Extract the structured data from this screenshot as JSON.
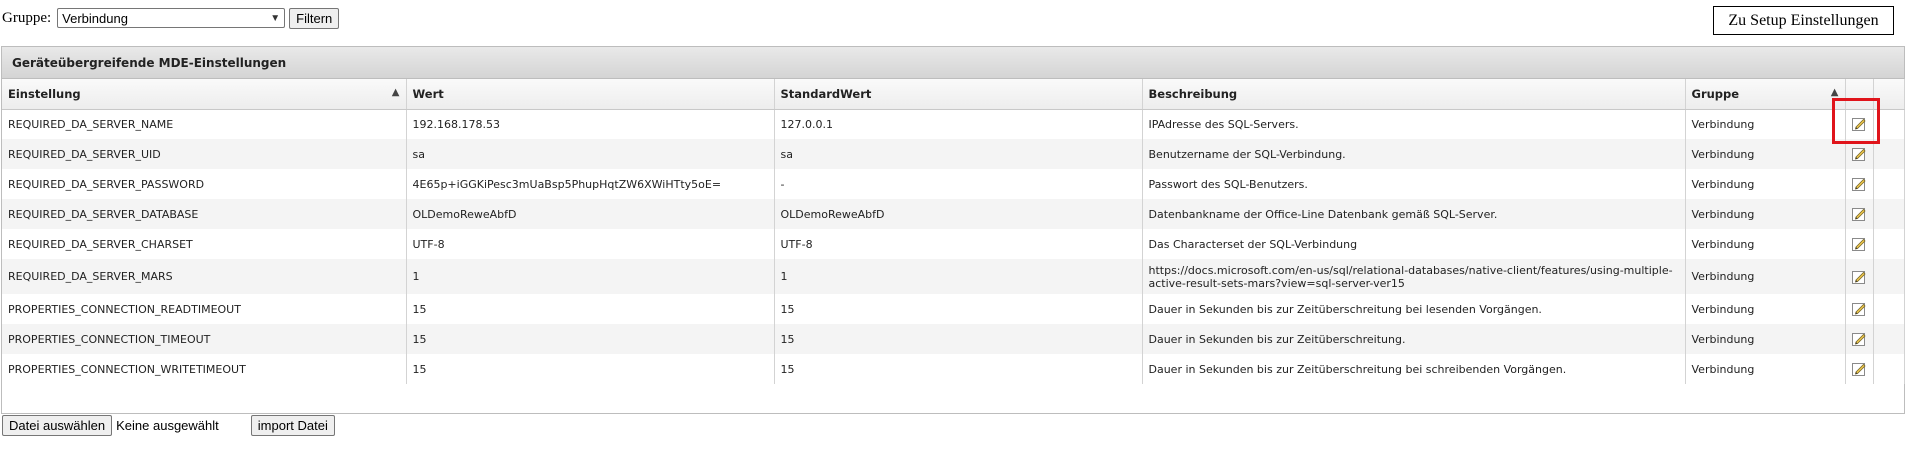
{
  "filter": {
    "label": "Gruppe:",
    "selected": "Verbindung",
    "button": "Filtern"
  },
  "setup_button": "Zu Setup Einstellungen",
  "grid": {
    "title": "Geräteübergreifende MDE-Einstellungen",
    "columns": [
      "Einstellung",
      "Wert",
      "StandardWert",
      "Beschreibung",
      "Gruppe"
    ],
    "rows": [
      {
        "einstellung": "REQUIRED_DA_SERVER_NAME",
        "wert": "192.168.178.53",
        "standard": "127.0.0.1",
        "beschreibung": "IPAdresse des SQL-Servers.",
        "gruppe": "Verbindung"
      },
      {
        "einstellung": "REQUIRED_DA_SERVER_UID",
        "wert": "sa",
        "standard": "sa",
        "beschreibung": "Benutzername der SQL-Verbindung.",
        "gruppe": "Verbindung"
      },
      {
        "einstellung": "REQUIRED_DA_SERVER_PASSWORD",
        "wert": "4E65p+iGGKiPesc3mUaBsp5PhupHqtZW6XWiHTty5oE=",
        "standard": "-",
        "beschreibung": "Passwort des SQL-Benutzers.",
        "gruppe": "Verbindung"
      },
      {
        "einstellung": "REQUIRED_DA_SERVER_DATABASE",
        "wert": "OLDemoReweAbfD",
        "standard": "OLDemoReweAbfD",
        "beschreibung": "Datenbankname der Office-Line Datenbank gemäß SQL-Server.",
        "gruppe": "Verbindung"
      },
      {
        "einstellung": "REQUIRED_DA_SERVER_CHARSET",
        "wert": "UTF-8",
        "standard": "UTF-8",
        "beschreibung": "Das Characterset der SQL-Verbindung",
        "gruppe": "Verbindung"
      },
      {
        "einstellung": "REQUIRED_DA_SERVER_MARS",
        "wert": "1",
        "standard": "1",
        "beschreibung": "https://docs.microsoft.com/en-us/sql/relational-databases/native-client/features/using-multiple-active-result-sets-mars?view=sql-server-ver15",
        "gruppe": "Verbindung"
      },
      {
        "einstellung": "PROPERTIES_CONNECTION_READTIMEOUT",
        "wert": "15",
        "standard": "15",
        "beschreibung": "Dauer in Sekunden bis zur Zeitüberschreitung bei lesenden Vorgängen.",
        "gruppe": "Verbindung"
      },
      {
        "einstellung": "PROPERTIES_CONNECTION_TIMEOUT",
        "wert": "15",
        "standard": "15",
        "beschreibung": "Dauer in Sekunden bis zur Zeitüberschreitung.",
        "gruppe": "Verbindung"
      },
      {
        "einstellung": "PROPERTIES_CONNECTION_WRITETIMEOUT",
        "wert": "15",
        "standard": "15",
        "beschreibung": "Dauer in Sekunden bis zur Zeitüberschreitung bei schreibenden Vorgängen.",
        "gruppe": "Verbindung"
      }
    ],
    "row_icon": "edit-pencil-icon",
    "sort_icon": "sort-ascending-icon"
  },
  "file": {
    "choose_button": "Datei auswählen",
    "status": "Keine ausgewählt",
    "import_button": "import Datei"
  },
  "colors": {
    "highlight": "#e0141b"
  }
}
